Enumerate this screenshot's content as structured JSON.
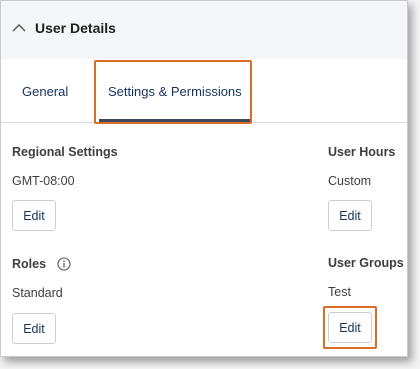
{
  "panel": {
    "title": "User Details",
    "collapse_icon": "chevron-up-icon"
  },
  "tabs": [
    {
      "label": "General",
      "selected": false
    },
    {
      "label": "Settings & Permissions",
      "selected": true
    }
  ],
  "sections": {
    "regional_settings": {
      "label": "Regional Settings",
      "value": "GMT-08:00",
      "button": "Edit"
    },
    "user_hours": {
      "label": "User Hours",
      "value": "Custom",
      "button": "Edit"
    },
    "roles": {
      "label": "Roles",
      "value": "Standard",
      "button": "Edit",
      "icon": "info-icon"
    },
    "user_groups": {
      "label": "User Groups",
      "value": "Test",
      "button": "Edit"
    }
  },
  "colors": {
    "highlight": "#d96d2a",
    "link_text": "#16325c",
    "tab_underline": "#3d4b5c"
  }
}
